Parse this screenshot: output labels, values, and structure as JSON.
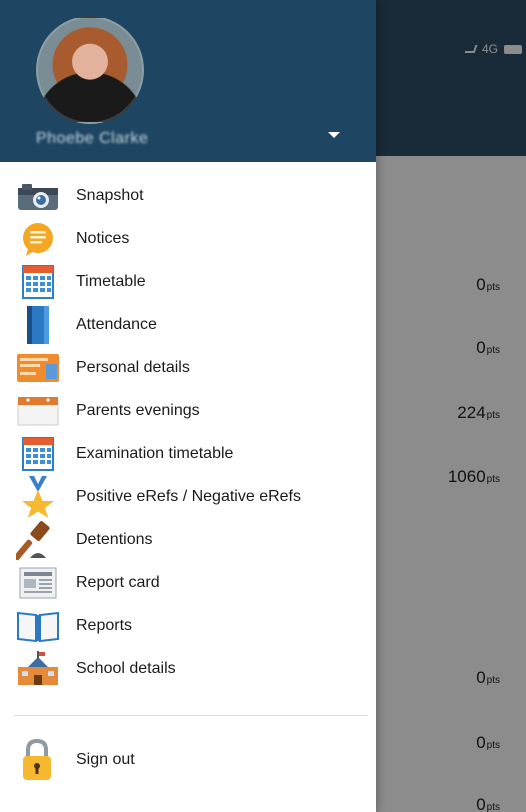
{
  "background": {
    "status_text": "4G",
    "rows": [
      {
        "value": "0",
        "unit": "pts"
      },
      {
        "value": "0",
        "unit": "pts"
      },
      {
        "value": "224",
        "unit": "pts"
      },
      {
        "value": "1060",
        "unit": "pts"
      },
      {
        "value": "0",
        "unit": "pts"
      },
      {
        "value": "0",
        "unit": "pts"
      },
      {
        "value": "0",
        "unit": "pts"
      }
    ]
  },
  "drawer": {
    "user_name": "Phoebe Clarke",
    "menu": [
      {
        "label": "Snapshot",
        "icon": "camera-icon"
      },
      {
        "label": "Notices",
        "icon": "notice-bubble-icon"
      },
      {
        "label": "Timetable",
        "icon": "calendar-icon"
      },
      {
        "label": "Attendance",
        "icon": "register-book-icon"
      },
      {
        "label": "Personal details",
        "icon": "id-card-icon"
      },
      {
        "label": "Parents evenings",
        "icon": "calendar-page-icon"
      },
      {
        "label": "Examination timetable",
        "icon": "calendar-icon"
      },
      {
        "label": "Positive eRefs / Negative eRefs",
        "icon": "medal-icon"
      },
      {
        "label": "Detentions",
        "icon": "gavel-icon"
      },
      {
        "label": "Report card",
        "icon": "newspaper-icon"
      },
      {
        "label": "Reports",
        "icon": "open-book-icon"
      },
      {
        "label": "School details",
        "icon": "school-building-icon"
      }
    ],
    "sign_out": {
      "label": "Sign out",
      "icon": "padlock-icon"
    }
  }
}
